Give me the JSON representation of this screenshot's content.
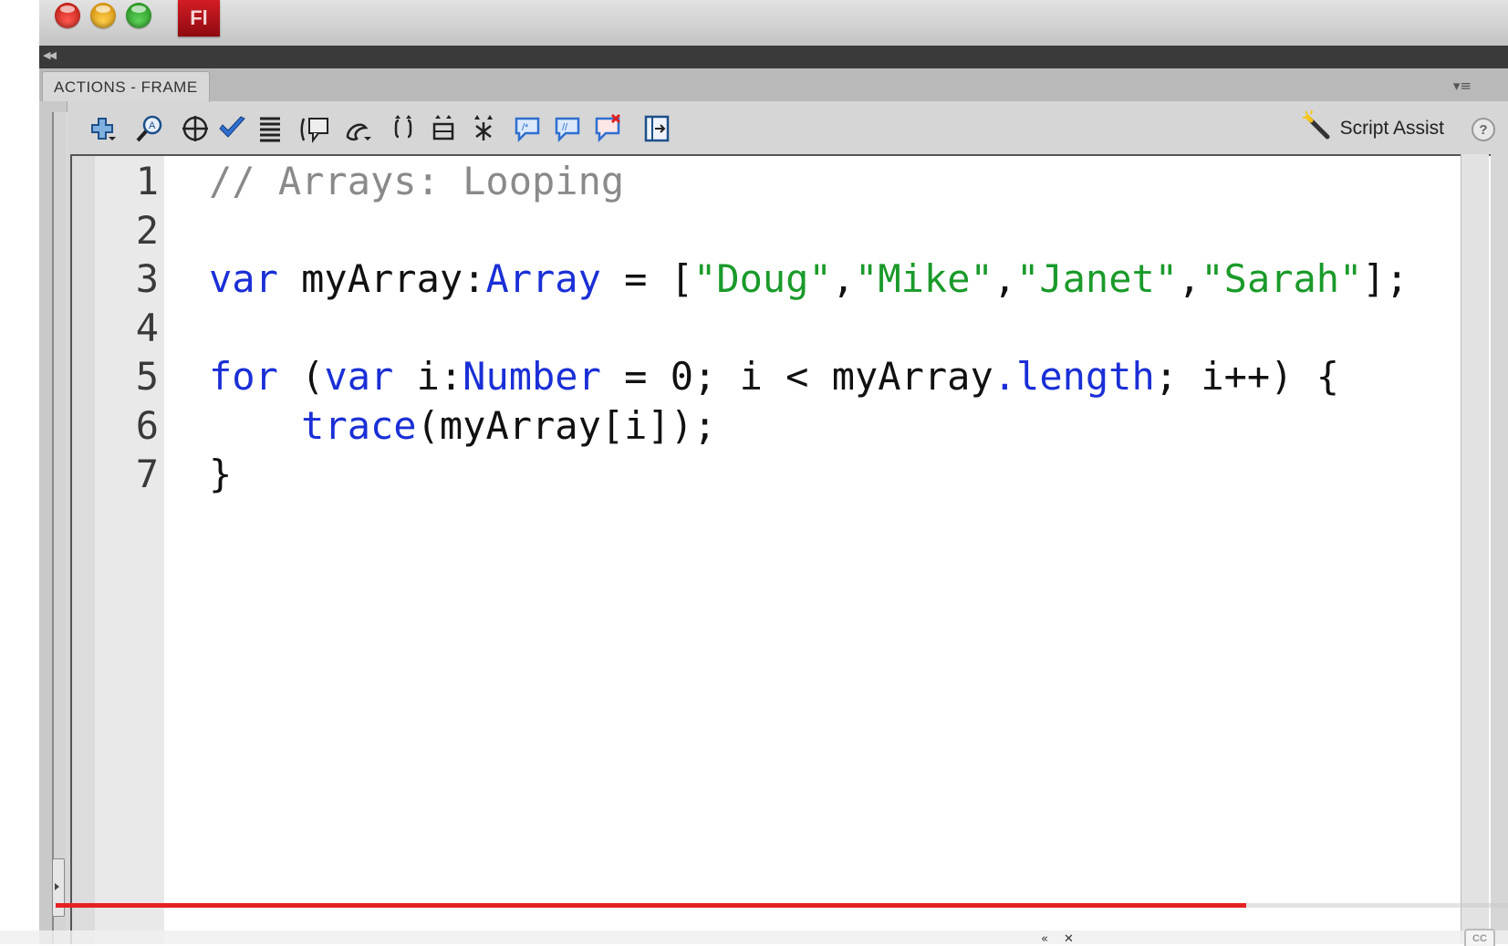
{
  "window": {
    "app_badge": "Fl"
  },
  "panel": {
    "tab_label": "ACTIONS - FRAME",
    "menu_glyph": "▾≡"
  },
  "toolbar": {
    "script_assist_label": "Script Assist",
    "help_label": "?"
  },
  "editor": {
    "line_numbers": [
      "1",
      "2",
      "3",
      "4",
      "5",
      "6",
      "7"
    ],
    "lines": [
      [
        {
          "t": "// Arrays: Looping",
          "c": "comment"
        }
      ],
      [],
      [
        {
          "t": "var",
          "c": "kw"
        },
        {
          "t": " myArray:",
          "c": "plain"
        },
        {
          "t": "Array",
          "c": "type"
        },
        {
          "t": " = [",
          "c": "plain"
        },
        {
          "t": "\"Doug\"",
          "c": "str"
        },
        {
          "t": ",",
          "c": "plain"
        },
        {
          "t": "\"Mike\"",
          "c": "str"
        },
        {
          "t": ",",
          "c": "plain"
        },
        {
          "t": "\"Janet\"",
          "c": "str"
        },
        {
          "t": ",",
          "c": "plain"
        },
        {
          "t": "\"Sarah\"",
          "c": "str"
        },
        {
          "t": "];",
          "c": "plain"
        }
      ],
      [],
      [
        {
          "t": "for",
          "c": "kw"
        },
        {
          "t": " (",
          "c": "plain"
        },
        {
          "t": "var",
          "c": "kw"
        },
        {
          "t": " i:",
          "c": "plain"
        },
        {
          "t": "Number",
          "c": "type"
        },
        {
          "t": " = 0; i < myArray",
          "c": "plain"
        },
        {
          "t": ".length",
          "c": "type"
        },
        {
          "t": "; i++) {",
          "c": "plain"
        }
      ],
      [
        {
          "t": "    ",
          "c": "plain"
        },
        {
          "t": "trace",
          "c": "kw"
        },
        {
          "t": "(myArray[i]);",
          "c": "plain"
        }
      ],
      [
        {
          "t": "}",
          "c": "plain"
        }
      ]
    ]
  },
  "video": {
    "progress_fraction": 0.82,
    "cc_label": "CC"
  },
  "colors": {
    "keyword": "#1a2fd6",
    "string": "#1a9a2a",
    "comment": "#8a8a8a",
    "progress": "#e52222"
  }
}
